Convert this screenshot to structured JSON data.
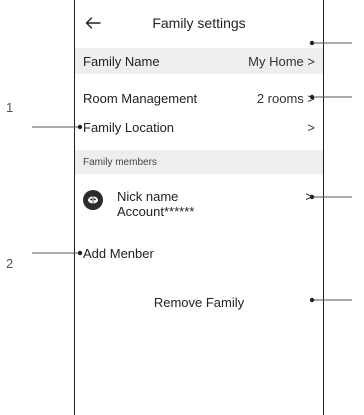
{
  "header": {
    "title": "Family settings",
    "back_icon": "arrow-left-icon"
  },
  "family_name": {
    "label": "Family Name",
    "value": "My Home >"
  },
  "room_management": {
    "label": "Room Management",
    "value": "2 rooms >"
  },
  "family_location": {
    "label": "Family Location",
    "chevron": ">"
  },
  "members_section": {
    "title": "Family members"
  },
  "member": {
    "name": "Nick name",
    "account": "Account******",
    "chevron": ">",
    "avatar_icon": "user-avatar-icon"
  },
  "add_member": {
    "label": "Add Menber"
  },
  "remove_family": {
    "label": "Remove Family"
  },
  "callouts": {
    "one": "1",
    "two": "2"
  },
  "colors": {
    "frame": "#1e1e1e",
    "row_shade": "#eeeeee",
    "callout_line": "#555555"
  }
}
